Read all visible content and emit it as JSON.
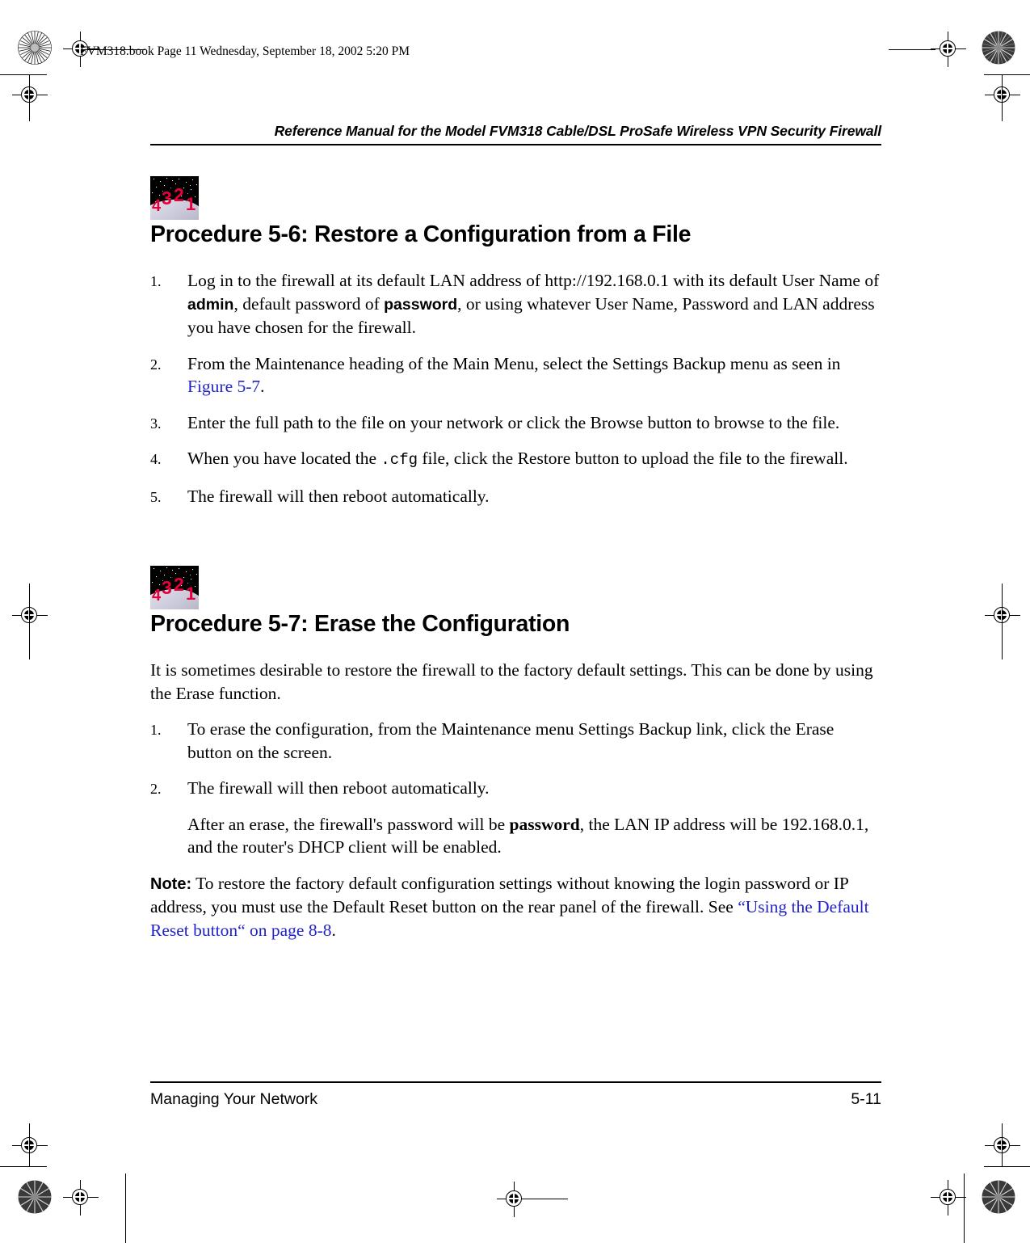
{
  "file_stamp": "FVM318.book  Page 11  Wednesday, September 18, 2002  5:20 PM",
  "header": {
    "running_title": "Reference Manual for the Model FVM318 Cable/DSL ProSafe Wireless VPN Security Firewall"
  },
  "footer": {
    "section_title": "Managing Your Network",
    "page_number": "5-11"
  },
  "icons": {
    "countdown_numbers": [
      "4",
      "3",
      "2",
      "1"
    ],
    "countdown_color": "#e8003c",
    "countdown_background": "#000000"
  },
  "colors": {
    "link": "#2222cc",
    "text": "#000000",
    "page_background": "#ffffff"
  },
  "procedures": [
    {
      "heading": "Procedure 5-6:  Restore a Configuration from a File",
      "steps": [
        {
          "marker": "1.",
          "parts": [
            {
              "type": "text",
              "value": "Log in to the firewall at its default LAN address of http://192.168.0.1 with its default User Name of "
            },
            {
              "type": "bold_sans",
              "value": "admin"
            },
            {
              "type": "text",
              "value": ", default password of "
            },
            {
              "type": "bold_sans",
              "value": "password"
            },
            {
              "type": "text",
              "value": ", or using whatever User Name, Password and LAN address you have chosen for the firewall."
            }
          ]
        },
        {
          "marker": "2.",
          "parts": [
            {
              "type": "text",
              "value": "From the Maintenance heading of the Main Menu, select the Settings Backup menu as seen in "
            },
            {
              "type": "link",
              "value": "Figure 5-7"
            },
            {
              "type": "text",
              "value": "."
            }
          ]
        },
        {
          "marker": "3.",
          "parts": [
            {
              "type": "text",
              "value": "Enter the full path to the file on your network or click the Browse button to browse to the file."
            }
          ]
        },
        {
          "marker": "4.",
          "parts": [
            {
              "type": "text",
              "value": "When you have located the "
            },
            {
              "type": "mono",
              "value": ".cfg"
            },
            {
              "type": "text",
              "value": " file, click the Restore button to upload the file to the firewall."
            }
          ]
        },
        {
          "marker": "5.",
          "parts": [
            {
              "type": "text",
              "value": "The firewall will then reboot automatically."
            }
          ]
        }
      ]
    },
    {
      "heading": "Procedure 5-7:  Erase the Configuration",
      "intro": "It is sometimes desirable to restore the firewall to the factory default settings. This can be done by using the Erase function.",
      "steps": [
        {
          "marker": "1.",
          "parts": [
            {
              "type": "text",
              "value": "To erase the configuration, from the Maintenance menu Settings Backup link, click the Erase button on the screen."
            }
          ]
        },
        {
          "marker": "2.",
          "parts": [
            {
              "type": "text",
              "value": "The firewall will then reboot automatically."
            }
          ],
          "follow_up": [
            {
              "type": "text",
              "value": "After an erase, the firewall's password will be "
            },
            {
              "type": "bold_serif",
              "value": "password"
            },
            {
              "type": "text",
              "value": ", the LAN IP address will be 192.168.0.1, and the router's DHCP client will be enabled."
            }
          ]
        }
      ],
      "note": [
        {
          "type": "note_label",
          "value": "Note:"
        },
        {
          "type": "text",
          "value": " To restore the factory default configuration settings without knowing the login password or IP address, you must use the Default Reset button on the rear panel of the firewall. See "
        },
        {
          "type": "link",
          "value": "“Using the Default Reset button“ on page 8-8"
        },
        {
          "type": "text",
          "value": "."
        }
      ]
    }
  ]
}
